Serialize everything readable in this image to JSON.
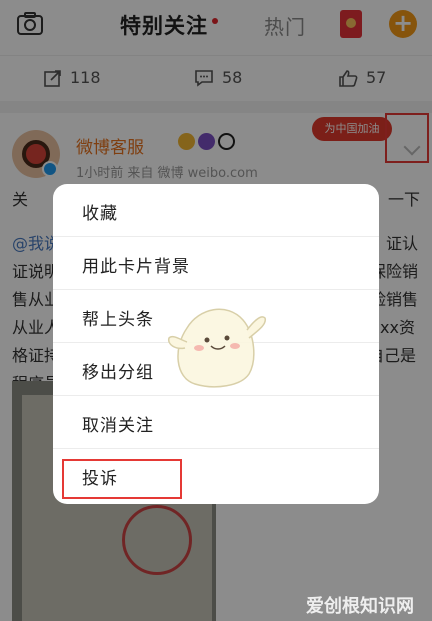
{
  "header": {
    "tab_following": "特别关注",
    "tab_hot": "热门",
    "plus_label": "+"
  },
  "actions": {
    "reposts": "118",
    "comments": "58",
    "likes": "57"
  },
  "post": {
    "author": "微博客服",
    "meta": "1小时前  来自 微博 weibo.com",
    "banner": "为中国加油",
    "lines": [
      "关",
      "@我说",
      "证说明",
      "售从业",
      "从业人",
      "格证持",
      "程序员"
    ],
    "line_right": [
      "一下",
      "证认",
      "保险销",
      "险销售",
      "xx资",
      "自己是",
      ""
    ]
  },
  "menu": {
    "items": [
      "收藏",
      "用此卡片背景",
      "帮上头条",
      "移出分组",
      "取消关注",
      "投诉"
    ]
  },
  "watermark": "爱创根知识网",
  "colors": {
    "accent_orange": "#f49a17",
    "author_orange": "#e8731f",
    "highlight_red": "#e53935",
    "link_blue": "#4a7bc1"
  }
}
